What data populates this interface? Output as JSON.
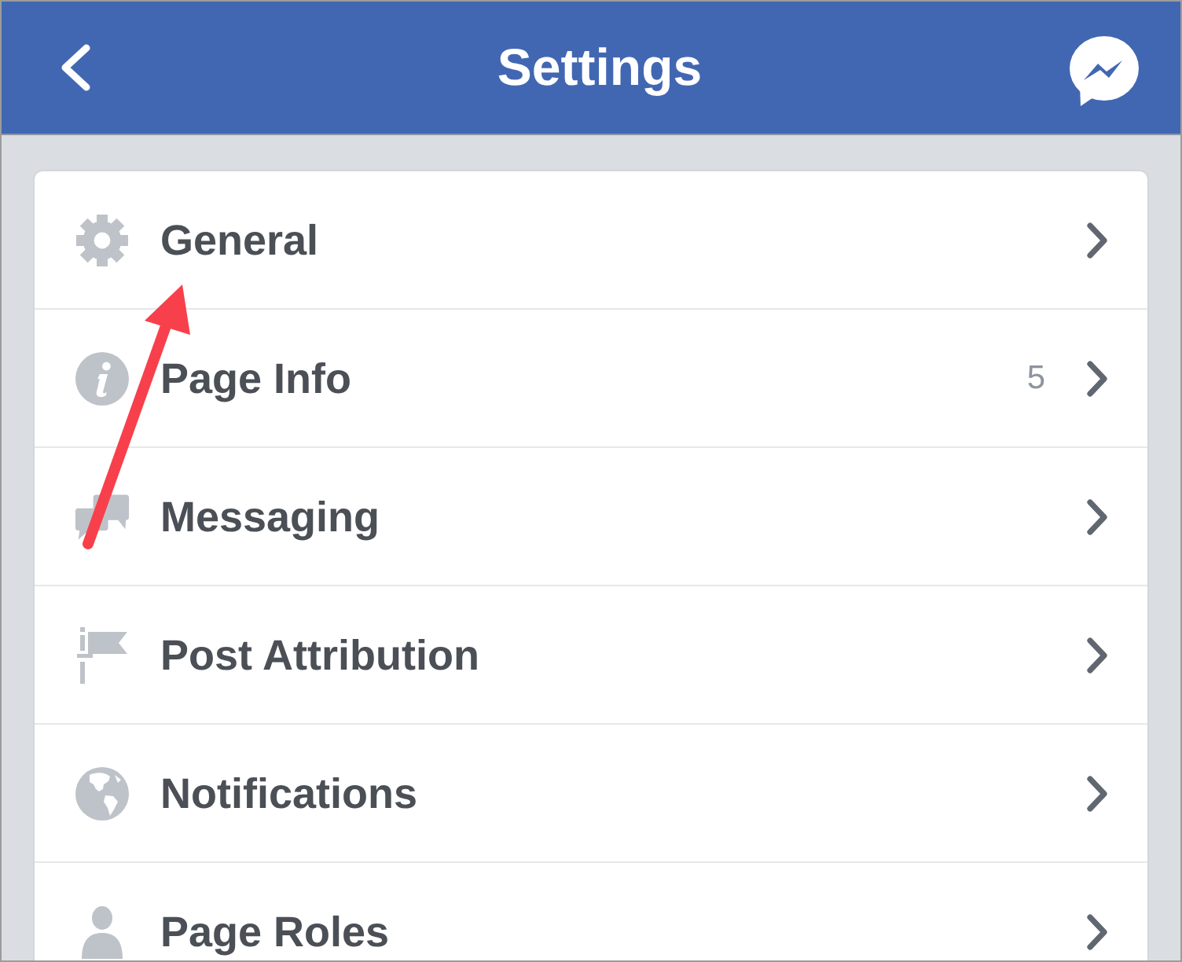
{
  "header": {
    "title": "Settings"
  },
  "settings_items": [
    {
      "label": "General"
    },
    {
      "label": "Page Info",
      "count": "5"
    },
    {
      "label": "Messaging"
    },
    {
      "label": "Post Attribution"
    },
    {
      "label": "Notifications"
    },
    {
      "label": "Page Roles"
    }
  ],
  "annotations": [
    {
      "kind": "arrow"
    }
  ]
}
